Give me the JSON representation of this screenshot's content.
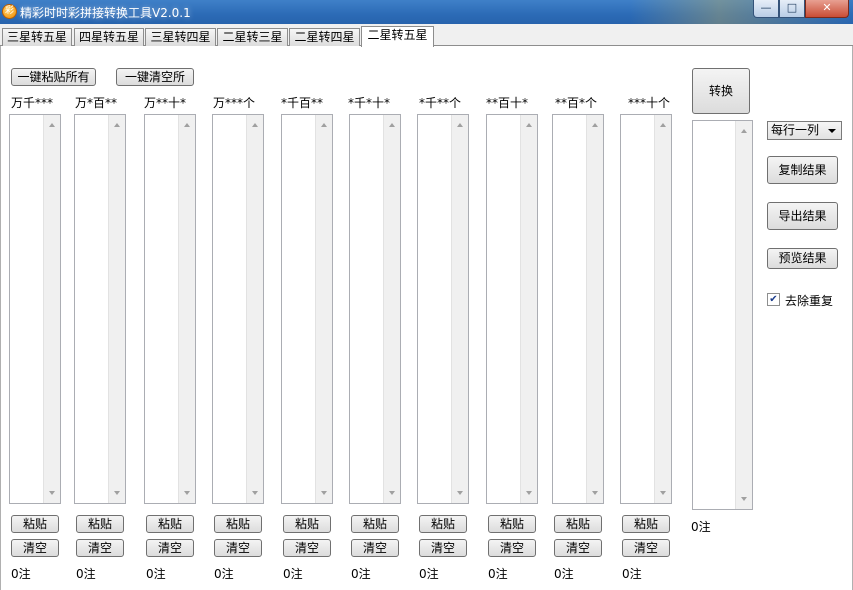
{
  "window": {
    "title": "精彩时时彩拼接转换工具V2.0.1",
    "icon": "app-logo-icon",
    "controls": {
      "minimize": "—",
      "maximize": "□",
      "close": "✕"
    }
  },
  "tabs": [
    {
      "label": "三星转五星"
    },
    {
      "label": "四星转五星"
    },
    {
      "label": "三星转四星"
    },
    {
      "label": "二星转三星"
    },
    {
      "label": "二星转四星"
    },
    {
      "label": "二星转五星",
      "active": true
    }
  ],
  "top_buttons": {
    "paste_all": "一键粘贴所有",
    "clear_all": "一键清空所"
  },
  "columns": [
    {
      "label": "万千***",
      "paste": "粘贴",
      "clear": "清空",
      "count": "0注"
    },
    {
      "label": "万*百**",
      "paste": "粘贴",
      "clear": "清空",
      "count": "0注"
    },
    {
      "label": "万**十*",
      "paste": "粘贴",
      "clear": "清空",
      "count": "0注"
    },
    {
      "label": "万***个",
      "paste": "粘贴",
      "clear": "清空",
      "count": "0注"
    },
    {
      "label": "*千百**",
      "paste": "粘贴",
      "clear": "清空",
      "count": "0注"
    },
    {
      "label": "*千*十*",
      "paste": "粘贴",
      "clear": "清空",
      "count": "0注"
    },
    {
      "label": "*千**个",
      "paste": "粘贴",
      "clear": "清空",
      "count": "0注"
    },
    {
      "label": "**百十*",
      "paste": "粘贴",
      "clear": "清空",
      "count": "0注"
    },
    {
      "label": "**百*个",
      "paste": "粘贴",
      "clear": "清空",
      "count": "0注"
    },
    {
      "label": "***十个",
      "paste": "粘贴",
      "clear": "清空",
      "count": "0注"
    }
  ],
  "result": {
    "convert_button": "转换",
    "count": "0注",
    "format_select": "每行一列",
    "copy_button": "复制结果",
    "export_button": "导出结果",
    "preview_button": "预览结果",
    "dedupe_label": "去除重复",
    "dedupe_checked": true
  }
}
